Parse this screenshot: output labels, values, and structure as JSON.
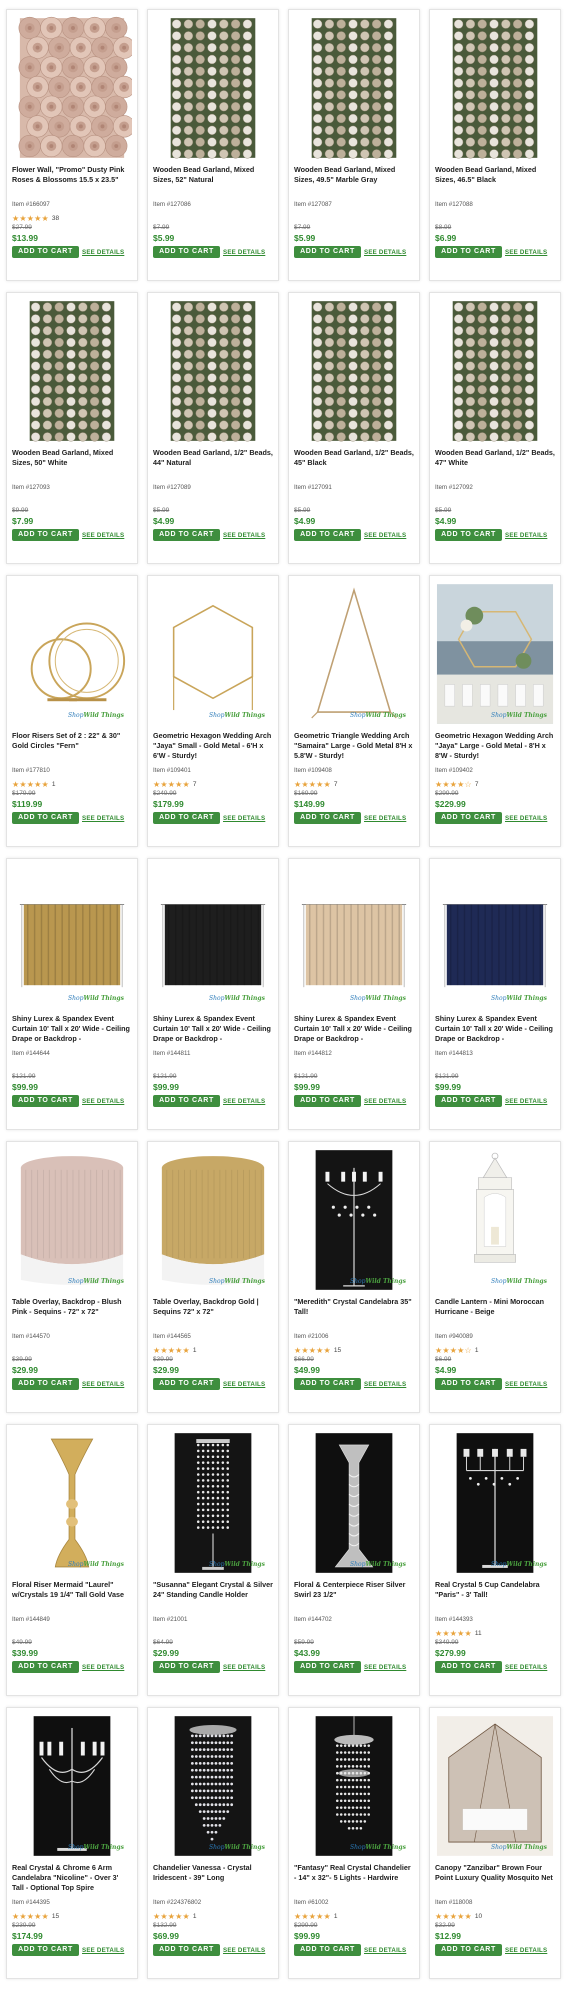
{
  "grid": {
    "products": [
      {
        "title": "Flower Wall, \"Promo\" Dusty Pink Roses & Blossoms 15.5 x 23.5\"",
        "item": "Item #166097",
        "stars": "★★★★★",
        "review_count": "38",
        "old_price": "$27.99",
        "price": "$13.99",
        "add_label": "ADD TO CART",
        "details_label": "SEE DETAILS",
        "image": "flower-wall"
      },
      {
        "title": "Wooden Bead Garland, Mixed Sizes, 52\" Natural",
        "item": "Item #127086",
        "stars": "",
        "review_count": "",
        "old_price": "$7.99",
        "price": "$5.99",
        "add_label": "ADD TO CART",
        "details_label": "SEE DETAILS",
        "image": "bead-garland"
      },
      {
        "title": "Wooden Bead Garland, Mixed Sizes, 49.5\" Marble Gray",
        "item": "Item #127087",
        "stars": "",
        "review_count": "",
        "old_price": "$7.99",
        "price": "$5.99",
        "add_label": "ADD TO CART",
        "details_label": "SEE DETAILS",
        "image": "bead-garland"
      },
      {
        "title": "Wooden Bead Garland, Mixed Sizes, 46.5\" Black",
        "item": "Item #127088",
        "stars": "",
        "review_count": "",
        "old_price": "$8.99",
        "price": "$6.99",
        "add_label": "ADD TO CART",
        "details_label": "SEE DETAILS",
        "image": "bead-garland"
      },
      {
        "title": "Wooden Bead Garland, Mixed Sizes, 50\" White",
        "item": "Item #127093",
        "stars": "",
        "review_count": "",
        "old_price": "$9.99",
        "price": "$7.99",
        "add_label": "ADD TO CART",
        "details_label": "SEE DETAILS",
        "image": "bead-garland"
      },
      {
        "title": "Wooden Bead Garland, 1/2\" Beads, 44\" Natural",
        "item": "Item #127089",
        "stars": "",
        "review_count": "",
        "old_price": "$5.99",
        "price": "$4.99",
        "add_label": "ADD TO CART",
        "details_label": "SEE DETAILS",
        "image": "bead-garland"
      },
      {
        "title": "Wooden Bead Garland, 1/2\" Beads, 45\" Black",
        "item": "Item #127091",
        "stars": "",
        "review_count": "",
        "old_price": "$5.99",
        "price": "$4.99",
        "add_label": "ADD TO CART",
        "details_label": "SEE DETAILS",
        "image": "bead-garland"
      },
      {
        "title": "Wooden Bead Garland, 1/2\" Beads, 47\" White",
        "item": "Item #127092",
        "stars": "",
        "review_count": "",
        "old_price": "$5.99",
        "price": "$4.99",
        "add_label": "ADD TO CART",
        "details_label": "SEE DETAILS",
        "image": "bead-garland"
      },
      {
        "title": "Floor Risers Set of 2 : 22\" & 30\" Gold Circles \"Fern\"",
        "item": "Item #177810",
        "stars": "★★★★★",
        "review_count": "1",
        "old_price": "$179.99",
        "price": "$119.99",
        "add_label": "ADD TO CART",
        "details_label": "SEE DETAILS",
        "image": "gold-circles"
      },
      {
        "title": "Geometric Hexagon Wedding Arch \"Jaya\" Small - Gold Metal - 6'H x 6'W - Sturdy!",
        "item": "Item #109401",
        "stars": "★★★★★",
        "review_count": "7",
        "old_price": "$249.99",
        "price": "$179.99",
        "add_label": "ADD TO CART",
        "details_label": "SEE DETAILS",
        "image": "hexagon-arch"
      },
      {
        "title": "Geometric Triangle Wedding Arch \"Samaira\" Large - Gold Metal 8'H x 5.8'W - Sturdy!",
        "item": "Item #109408",
        "stars": "★★★★★",
        "review_count": "7",
        "old_price": "$169.99",
        "price": "$149.99",
        "add_label": "ADD TO CART",
        "details_label": "SEE DETAILS",
        "image": "triangle-arch"
      },
      {
        "title": "Geometric Hexagon Wedding Arch \"Jaya\" Large - Gold Metal - 8'H x 8'W - Sturdy!",
        "item": "Item #109402",
        "stars": "★★★★☆",
        "review_count": "7",
        "old_price": "$299.99",
        "price": "$229.99",
        "add_label": "ADD TO CART",
        "details_label": "SEE DETAILS",
        "image": "arch-photo"
      },
      {
        "title": "Shiny Lurex & Spandex Event Curtain 10' Tall x 20' Wide - Ceiling Drape or Backdrop -",
        "item": "Item #144644",
        "stars": "",
        "review_count": "",
        "old_price": "$121.99",
        "price": "$99.99",
        "add_label": "ADD TO CART",
        "details_label": "SEE DETAILS",
        "image": "curtain-gold"
      },
      {
        "title": "Shiny Lurex & Spandex Event Curtain 10' Tall x 20' Wide - Ceiling Drape or Backdrop -",
        "item": "Item #144811",
        "stars": "",
        "review_count": "",
        "old_price": "$121.99",
        "price": "$99.99",
        "add_label": "ADD TO CART",
        "details_label": "SEE DETAILS",
        "image": "curtain-black"
      },
      {
        "title": "Shiny Lurex & Spandex Event Curtain 10' Tall x 20' Wide - Ceiling Drape or Backdrop -",
        "item": "Item #144812",
        "stars": "",
        "review_count": "",
        "old_price": "$121.99",
        "price": "$99.99",
        "add_label": "ADD TO CART",
        "details_label": "SEE DETAILS",
        "image": "curtain-champagne"
      },
      {
        "title": "Shiny Lurex & Spandex Event Curtain 10' Tall x 20' Wide - Ceiling Drape or Backdrop -",
        "item": "Item #144813",
        "stars": "",
        "review_count": "",
        "old_price": "$121.99",
        "price": "$99.99",
        "add_label": "ADD TO CART",
        "details_label": "SEE DETAILS",
        "image": "curtain-navy"
      },
      {
        "title": "Table Overlay, Backdrop - Blush Pink - Sequins - 72\" x 72\"",
        "item": "Item #144570",
        "stars": "",
        "review_count": "",
        "old_price": "$39.99",
        "price": "$29.99",
        "add_label": "ADD TO CART",
        "details_label": "SEE DETAILS",
        "image": "table-blush"
      },
      {
        "title": "Table Overlay, Backdrop Gold | Sequins 72\" x 72\"",
        "item": "Item #144565",
        "stars": "★★★★★",
        "review_count": "1",
        "old_price": "$39.99",
        "price": "$29.99",
        "add_label": "ADD TO CART",
        "details_label": "SEE DETAILS",
        "image": "table-gold"
      },
      {
        "title": "\"Meredith\" Crystal Candelabra 35\" Tall!",
        "item": "Item #21006",
        "stars": "★★★★★",
        "review_count": "15",
        "old_price": "$66.99",
        "price": "$49.99",
        "add_label": "ADD TO CART",
        "details_label": "SEE DETAILS",
        "image": "candelabra-dark"
      },
      {
        "title": "Candle Lantern - Mini Moroccan Hurricane - Beige",
        "item": "Item #940089",
        "stars": "★★★★☆",
        "review_count": "1",
        "old_price": "$6.99",
        "price": "$4.99",
        "add_label": "ADD TO CART",
        "details_label": "SEE DETAILS",
        "image": "lantern"
      },
      {
        "title": "Floral Riser Mermaid \"Laurel\" w/Crystals 19 1/4\" Tall Gold Vase",
        "item": "Item #144849",
        "stars": "",
        "review_count": "",
        "old_price": "$49.99",
        "price": "$39.99",
        "add_label": "ADD TO CART",
        "details_label": "SEE DETAILS",
        "image": "gold-vase"
      },
      {
        "title": "\"Susanna\" Elegant Crystal & Silver 24\" Standing Candle Holder",
        "item": "Item #21001",
        "stars": "",
        "review_count": "",
        "old_price": "$64.99",
        "price": "$29.99",
        "add_label": "ADD TO CART",
        "details_label": "SEE DETAILS",
        "image": "crystal-stand"
      },
      {
        "title": "Floral & Centerpiece Riser Silver Swirl 23 1/2\"",
        "item": "Item #144702",
        "stars": "",
        "review_count": "",
        "old_price": "$59.99",
        "price": "$43.99",
        "add_label": "ADD TO CART",
        "details_label": "SEE DETAILS",
        "image": "silver-swirl"
      },
      {
        "title": "Real Crystal 5 Cup Candelabra \"Paris\" - 3' Tall!",
        "item": "Item #144393",
        "stars": "★★★★★",
        "review_count": "11",
        "old_price": "$349.99",
        "price": "$279.99",
        "add_label": "ADD TO CART",
        "details_label": "SEE DETAILS",
        "image": "five-cup"
      },
      {
        "title": "Real Crystal & Chrome 6 Arm Candelabra \"Nicoline\" - Over 3' Tall - Optional Top Spire",
        "item": "Item #144395",
        "stars": "★★★★★",
        "review_count": "15",
        "old_price": "$239.99",
        "price": "$174.99",
        "add_label": "ADD TO CART",
        "details_label": "SEE DETAILS",
        "image": "six-arm"
      },
      {
        "title": "Chandelier Vanessa - Crystal Iridescent - 39\" Long",
        "item": "Item #224376802",
        "stars": "★★★★★",
        "review_count": "1",
        "old_price": "$132.99",
        "price": "$69.99",
        "add_label": "ADD TO CART",
        "details_label": "SEE DETAILS",
        "image": "chandelier-vanessa"
      },
      {
        "title": "\"Fantasy\" Real Crystal Chandelier - 14\" x 32\"- 5 Lights - Hardwire",
        "item": "Item #61002",
        "stars": "★★★★★",
        "review_count": "1",
        "old_price": "$299.99",
        "price": "$99.99",
        "add_label": "ADD TO CART",
        "details_label": "SEE DETAILS",
        "image": "chandelier-fantasy"
      },
      {
        "title": "Canopy \"Zanzibar\" Brown Four Point Luxury Quality Mosquito Net",
        "item": "Item #118008",
        "stars": "★★★★★",
        "review_count": "10",
        "old_price": "$32.99",
        "price": "$12.99",
        "add_label": "ADD TO CART",
        "details_label": "SEE DETAILS",
        "image": "canopy"
      }
    ]
  },
  "watermark": {
    "shop": "Shop",
    "brand": "Wild Things"
  },
  "colors": {
    "accent_green": "#3e8e3e",
    "price_green": "#2f8a2f",
    "star": "#e8a33c"
  }
}
